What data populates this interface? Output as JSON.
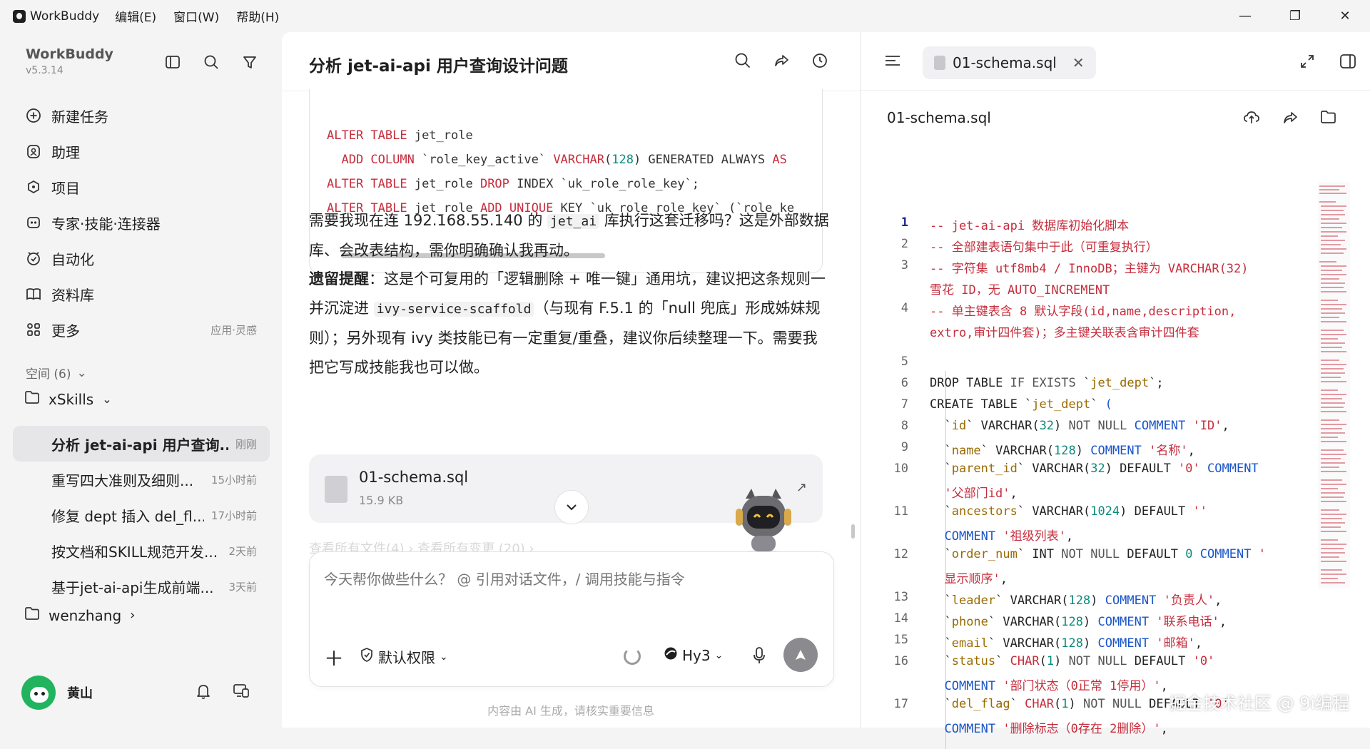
{
  "titlebar": {
    "app": "WorkBuddy",
    "menus": [
      "编辑(E)",
      "窗口(W)",
      "帮助(H)"
    ],
    "minimize": "—",
    "maximize": "❐",
    "close": "✕"
  },
  "sidebar": {
    "name": "WorkBuddy",
    "version": "v5.3.14",
    "nav": [
      {
        "label": "新建任务",
        "icon": "new-task-icon"
      },
      {
        "label": "助理",
        "icon": "assistant-icon"
      },
      {
        "label": "项目",
        "icon": "project-icon"
      },
      {
        "label": "专家·技能·连接器",
        "icon": "expert-icon"
      },
      {
        "label": "自动化",
        "icon": "automation-icon"
      },
      {
        "label": "资料库",
        "icon": "library-icon"
      },
      {
        "label": "更多",
        "aside": "应用·灵感",
        "icon": "more-icon"
      }
    ],
    "space_label": "空间 (6)",
    "folder1": "xSkills",
    "tasks": [
      {
        "title": "分析 jet-ai-api 用户查询...",
        "time": "刚刚"
      },
      {
        "title": "重写四大准则及细则...",
        "time": "15小时前"
      },
      {
        "title": "修复 dept 插入 del_fl...",
        "time": "17小时前"
      },
      {
        "title": "按文档和SKILL规范开发...",
        "time": "2天前"
      },
      {
        "title": "基于jet-ai-api生成前端...",
        "time": "3天前"
      }
    ],
    "folder2": "wenzhang",
    "user": "黄山"
  },
  "chat": {
    "title": "分析 jet-ai-api 用户查询设计问题",
    "para1_a": "需要我现在连 192.168.55.140 的 ",
    "para1_code": "jet_ai",
    "para1_b": " 库执行这套迁移吗？这是外部数据库、会改表结构，需你明确确认我再动。",
    "para2_bold": "遗留提醒",
    "para2_a": "：这是个可复用的「逻辑删除 + 唯一键」通用坑，建议把这条规则一并沉淀进 ",
    "para2_code": "ivy-service-scaffold",
    "para2_b": "（与现有 F.5.1 的「null 兜底」形成姊妹规则）；另外现有 ivy 类技能已有一定重复/重叠，建议你后续整理一下。需要我把它写成技能我也可以做。",
    "file_name": "01-schema.sql",
    "file_size": "15.9 KB",
    "faded_links": "查看所有文件(4)  ›    查看所有变更 (20)  ›",
    "input_placeholder": "今天帮你做些什么？ @ 引用对话文件，/ 调用技能与指令",
    "permission": "默认权限",
    "model": "Hy3",
    "disclaimer": "内容由 AI 生成，请核实重要信息"
  },
  "filepanel": {
    "tab": "01-schema.sql",
    "file_title": "01-schema.sql",
    "line_numbers": [
      "1",
      "2",
      "3",
      "4",
      "5",
      "6",
      "7",
      "8",
      "9",
      "10",
      "11",
      "12",
      "13",
      "14",
      "15",
      "16",
      "17"
    ]
  },
  "watermark": "掘金技术社区 @ 9i编程",
  "colors": {
    "keyword": "#c62d3c",
    "number": "#0b8a7a",
    "active_task_bg": "#e6e6e8"
  }
}
